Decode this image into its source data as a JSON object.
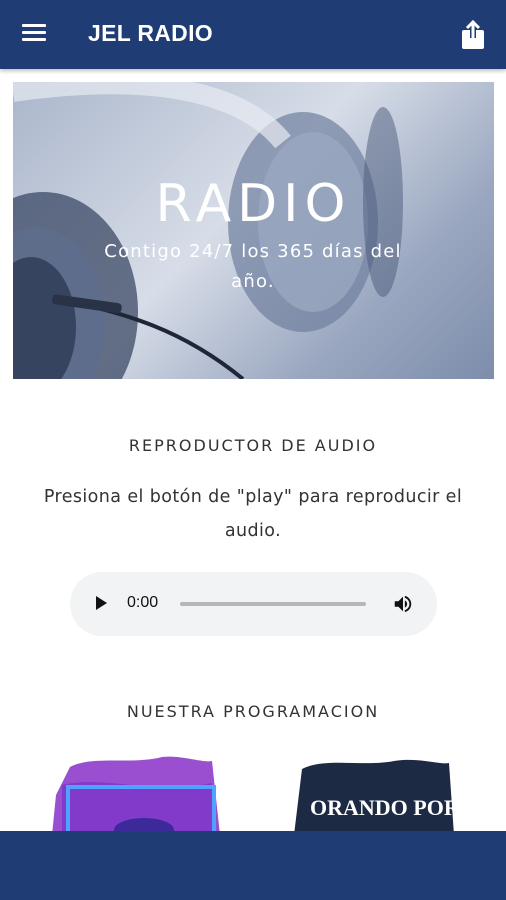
{
  "appbar": {
    "title": "JEL RADIO"
  },
  "hero": {
    "title": "RADIO",
    "subtitle": "Contigo 24/7 los 365 días del año."
  },
  "player_section": {
    "title": "REPRODUCTOR DE AUDIO",
    "description": "Presiona el botón de \"play\" para reproducir el audio.",
    "current_time": "0:00"
  },
  "programming": {
    "title": "NUESTRA PROGRAMACION",
    "cards": [
      {
        "label": ""
      },
      {
        "label": "ORANDO POR TI"
      }
    ]
  },
  "colors": {
    "primary": "#1f3c74",
    "player_bg": "#f1f3f4"
  },
  "icons": {
    "menu": "menu-icon",
    "share": "share-icon",
    "play": "play-icon",
    "volume": "volume-icon"
  }
}
